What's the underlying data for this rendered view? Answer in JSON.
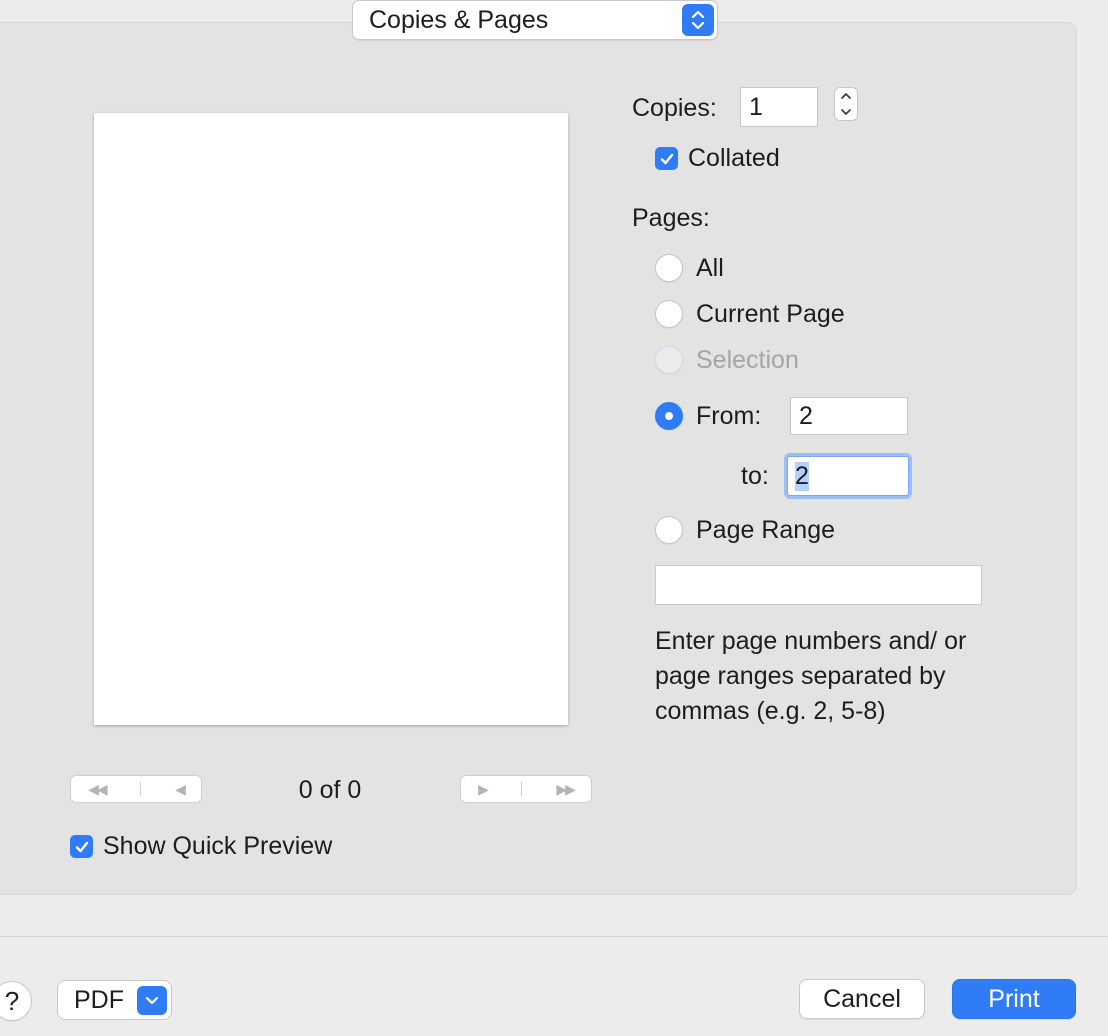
{
  "header": {
    "section_popup_label": "Copies & Pages"
  },
  "preview": {
    "page_count": "0 of 0",
    "show_quick_preview_label": "Show Quick Preview",
    "show_quick_preview_checked": true
  },
  "copies": {
    "label": "Copies:",
    "value": "1",
    "collated_label": "Collated",
    "collated_checked": true
  },
  "pages": {
    "label": "Pages:",
    "options": {
      "all": "All",
      "current_page": "Current Page",
      "selection": "Selection",
      "from": "From:",
      "to": "to:",
      "page_range": "Page Range"
    },
    "selected": "from",
    "from_value": "2",
    "to_value": "2",
    "page_range_value": "",
    "help_text": "Enter page numbers and/ or page ranges separated by commas (e.g. 2, 5-8)"
  },
  "footer": {
    "help_label": "?",
    "pdf_label": "PDF",
    "cancel_label": "Cancel",
    "print_label": "Print"
  },
  "colors": {
    "accent": "#2f7cf6",
    "panel": "#e3e3e4",
    "background": "#ececec"
  },
  "icons": {
    "popup": "up-down-chevron-icon",
    "pdf_dropdown": "chevron-down-icon",
    "nav_first": "first-page-icon",
    "nav_prev": "previous-page-icon",
    "nav_next": "next-page-icon",
    "nav_last": "last-page-icon"
  }
}
